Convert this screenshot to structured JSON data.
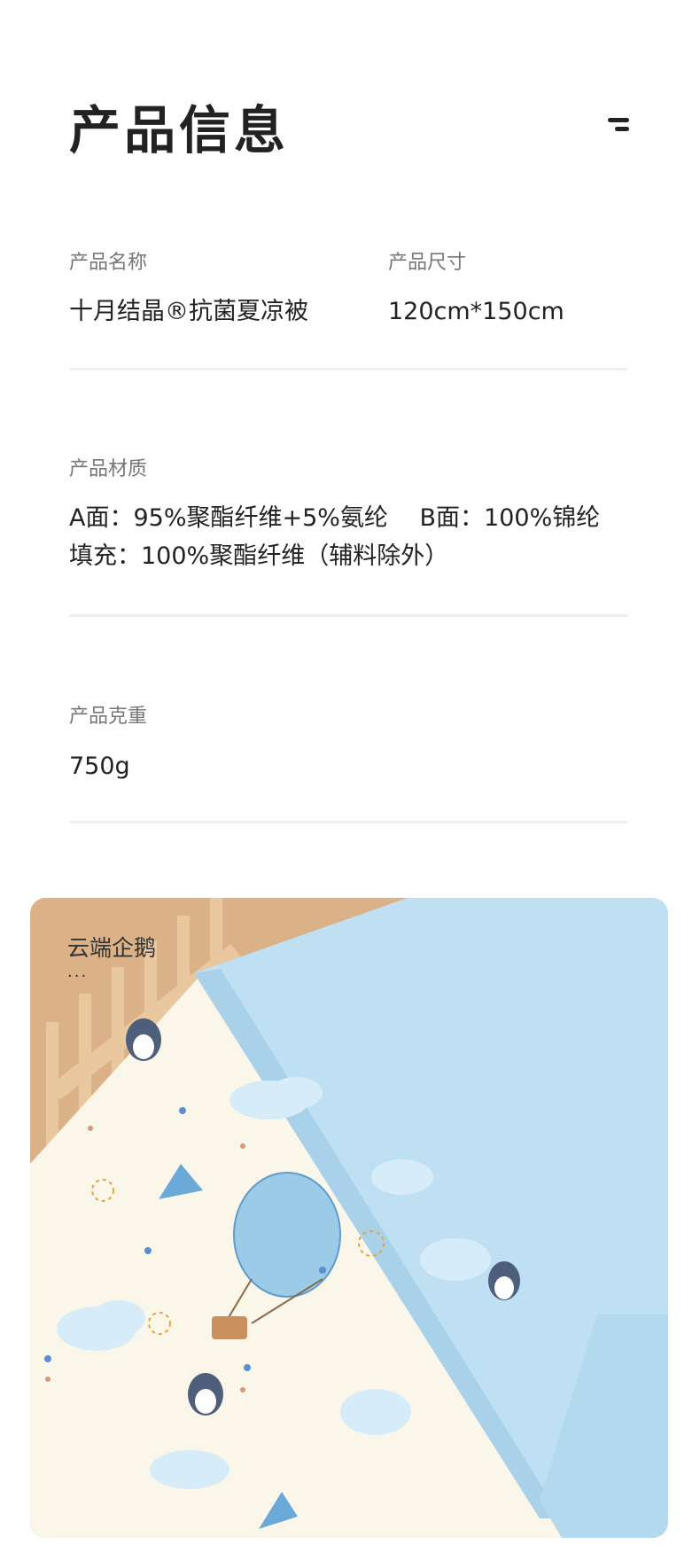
{
  "page": {
    "title": "产品信息"
  },
  "specs": {
    "name": {
      "label": "产品名称",
      "value": "十月结晶®抗菌夏凉被"
    },
    "size": {
      "label": "产品尺寸",
      "value": "120cm*150cm"
    },
    "material": {
      "label": "产品材质",
      "line1": "A面：95%聚酯纤维+5%氨纶　 B面：100%锦纶",
      "line2": "填充：100%聚酯纤维（辅料除外）"
    },
    "weight": {
      "label": "产品克重",
      "value": "750g"
    }
  },
  "photo": {
    "caption": "云端企鹅",
    "dots": "···"
  },
  "icons": {
    "logo": "brand-stripes-icon"
  },
  "colors": {
    "quilt_blue": "#bfe0f2",
    "quilt_cream": "#faf6ea",
    "wood": "#d9ad82"
  }
}
